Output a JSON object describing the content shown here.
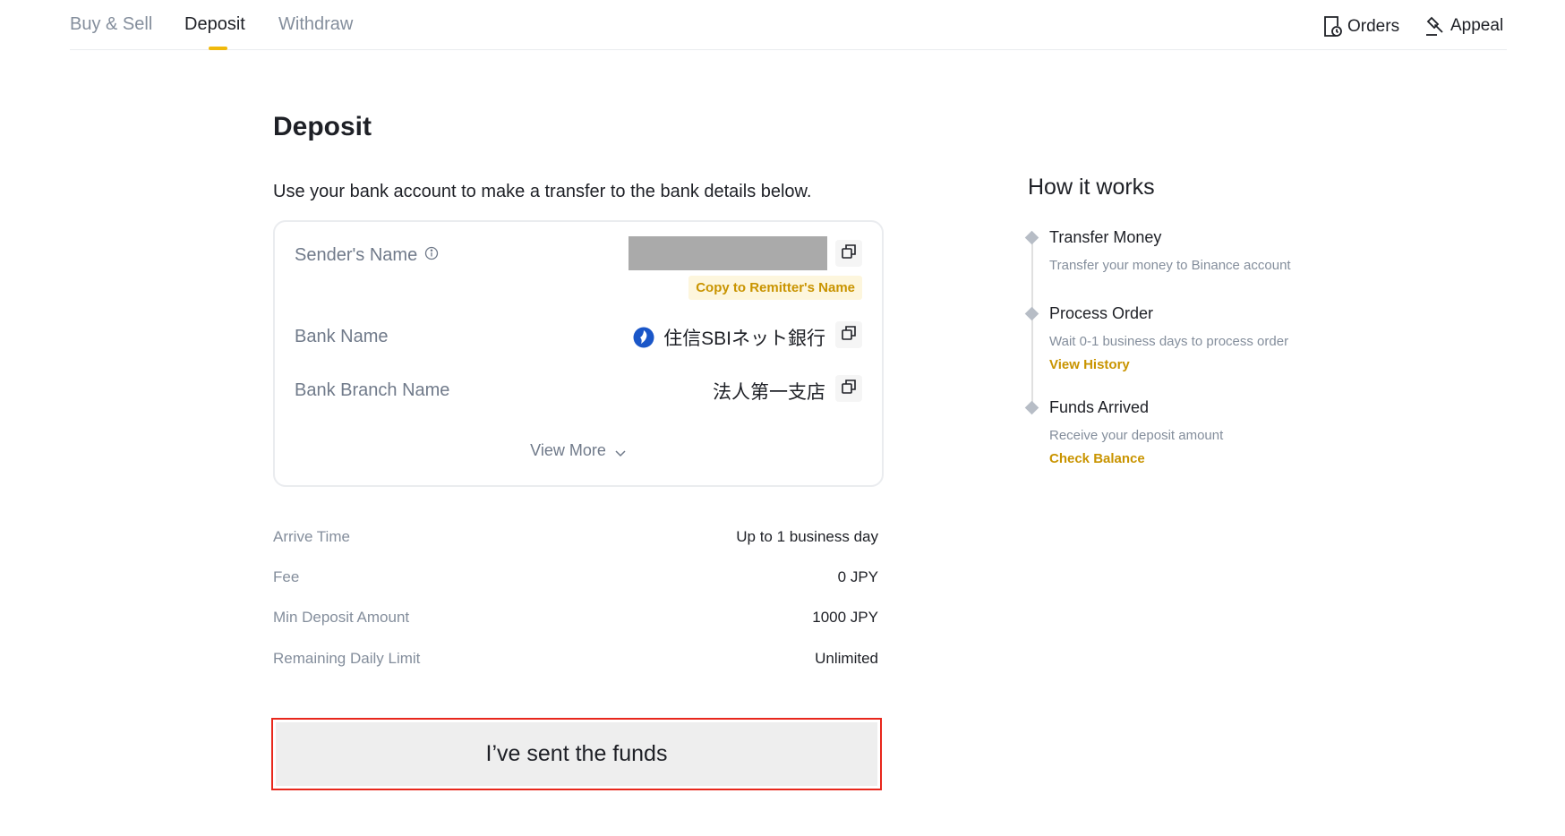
{
  "nav": {
    "tabs": [
      {
        "label": "Buy & Sell"
      },
      {
        "label": "Deposit"
      },
      {
        "label": "Withdraw"
      }
    ],
    "active_tab": "Deposit",
    "orders_label": "Orders",
    "appeal_label": "Appeal"
  },
  "deposit": {
    "title": "Deposit",
    "intro": "Use your bank account to make a transfer to the bank details below.",
    "details": {
      "sender_name_label": "Sender's Name",
      "remitter_tag": "Copy to Remitter's Name",
      "bank_name_label": "Bank Name",
      "bank_name_value": "住信SBIネット銀行",
      "branch_label": "Bank Branch Name",
      "branch_value": "法人第一支店",
      "view_more": "View More"
    },
    "info": [
      {
        "label": "Arrive Time",
        "value": "Up to 1 business day"
      },
      {
        "label": "Fee",
        "value": "0 JPY"
      },
      {
        "label": "Min Deposit Amount",
        "value": "1000 JPY"
      },
      {
        "label": "Remaining Daily Limit",
        "value": "Unlimited"
      }
    ],
    "sent_button": "I’ve sent the funds"
  },
  "how_it_works": {
    "title": "How it works",
    "steps": [
      {
        "title": "Transfer Money",
        "desc": "Transfer your money to Binance account",
        "link": ""
      },
      {
        "title": "Process Order",
        "desc": "Wait 0-1 business days to process order",
        "link": "View History"
      },
      {
        "title": "Funds Arrived",
        "desc": "Receive your deposit amount",
        "link": "Check Balance"
      }
    ]
  },
  "colors": {
    "accent": "#f0b90b",
    "link": "#c99400",
    "highlight_border": "#e8271c"
  }
}
